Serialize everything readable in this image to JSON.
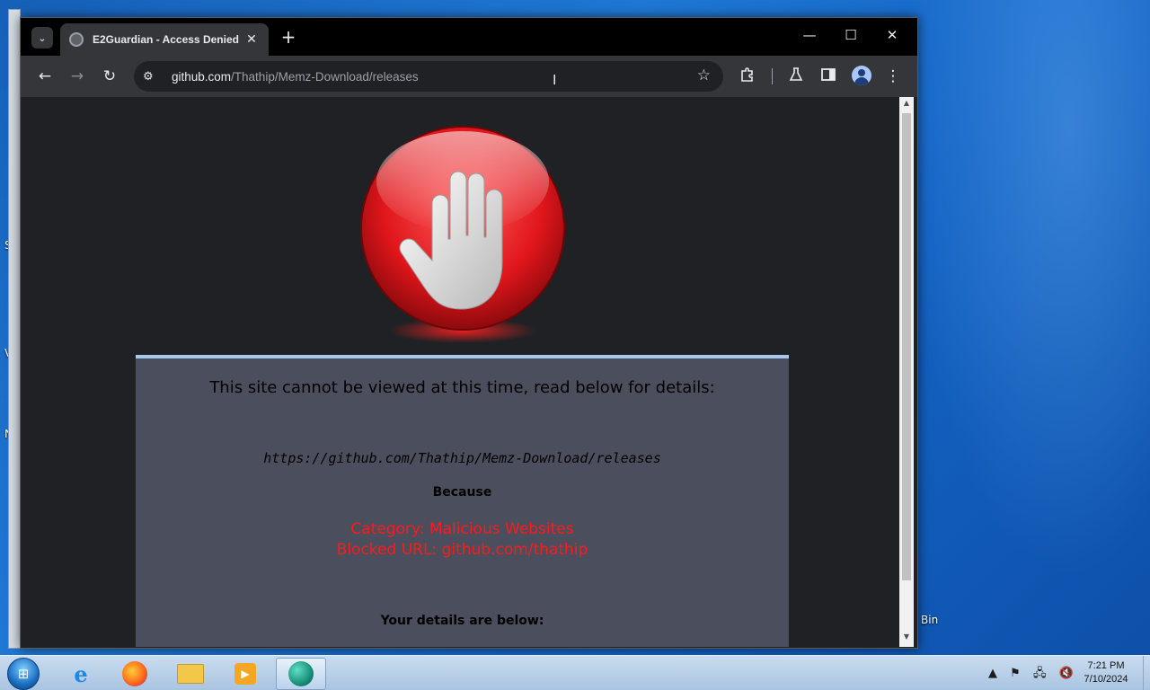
{
  "browser": {
    "tab": {
      "title": "E2Guardian - Access Denied"
    },
    "address": {
      "host": "github.com",
      "path": "/Thathip/Memz-Download/releases"
    }
  },
  "page": {
    "headline": "This site cannot be viewed at this time, read below for details:",
    "blocked_url": "https://github.com/Thathip/Memz-Download/releases",
    "because_label": "Because",
    "category": "Category: Malicious Websites",
    "blocked_reason": "Blocked URL: github.com/thathip",
    "details_label": "Your details are below:"
  },
  "desktop": {
    "recycle_bin_label": "Bin"
  },
  "taskbar": {
    "time": "7:21 PM",
    "date": "7/10/2024"
  },
  "icons": {
    "tab_search": "chevron-down-icon",
    "favicon": "github-icon",
    "back": "arrow-left-icon",
    "forward": "arrow-right-icon",
    "reload": "reload-icon",
    "site_info": "tune-icon",
    "bookmark": "star-icon",
    "extensions": "puzzle-icon",
    "labs": "flask-icon",
    "side_panel": "side-panel-icon",
    "profile": "profile-icon",
    "menu": "kebab-menu-icon",
    "stop": "stop-hand-icon"
  },
  "colors": {
    "panel_bg": "#4b4e5c",
    "panel_border": "#a6c8ec",
    "warning_text": "#ff1a1a",
    "browser_chrome": "#35363a"
  }
}
